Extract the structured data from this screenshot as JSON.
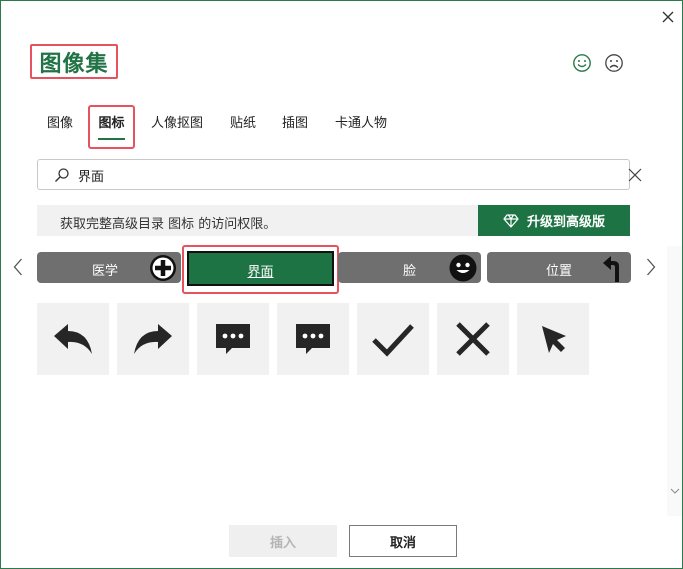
{
  "dialog": {
    "title": "图像集",
    "close_icon": "close-icon",
    "feedback": {
      "smile_icon": "smile-icon",
      "frown_icon": "frown-icon"
    }
  },
  "tabs": [
    {
      "label": "图像",
      "active": false
    },
    {
      "label": "图标",
      "active": true
    },
    {
      "label": "人像抠图",
      "active": false
    },
    {
      "label": "贴纸",
      "active": false
    },
    {
      "label": "插图",
      "active": false
    },
    {
      "label": "卡通人物",
      "active": false
    }
  ],
  "search": {
    "value": "界面",
    "icon": "search-icon",
    "clear_icon": "close-icon"
  },
  "banner": {
    "message": "获取完整高级目录 图标 的访问权限。",
    "upgrade_label": "升级到高级版",
    "upgrade_icon": "diamond-icon"
  },
  "categories": [
    {
      "label": "医学",
      "icon": "plus-circle-icon",
      "selected": false
    },
    {
      "label": "界面",
      "icon": "",
      "selected": true
    },
    {
      "label": "脸",
      "icon": "smiley-face-icon",
      "selected": false
    },
    {
      "label": "位置",
      "icon": "turn-arrow-icon",
      "selected": false
    }
  ],
  "icons": [
    {
      "name": "reply-arrow-icon"
    },
    {
      "name": "forward-arrow-icon"
    },
    {
      "name": "chat-bubble-icon"
    },
    {
      "name": "chat-bubble-icon"
    },
    {
      "name": "checkmark-icon"
    },
    {
      "name": "x-mark-icon"
    },
    {
      "name": "cursor-arrow-icon"
    }
  ],
  "footer": {
    "insert_label": "插入",
    "cancel_label": "取消"
  },
  "colors": {
    "accent": "#1e7345",
    "highlight": "#e6535f",
    "category_bg": "#6f6f6f"
  }
}
